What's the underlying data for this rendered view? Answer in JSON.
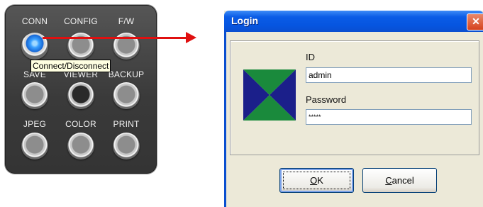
{
  "panel": {
    "buttons": [
      {
        "label": "CONN",
        "style": "blue"
      },
      {
        "label": "CONFIG",
        "style": "gray"
      },
      {
        "label": "F/W",
        "style": "gray"
      },
      {
        "label": "SAVE",
        "style": "gray"
      },
      {
        "label": "VIEWER",
        "style": "dark"
      },
      {
        "label": "BACKUP",
        "style": "gray"
      },
      {
        "label": "JPEG",
        "style": "gray"
      },
      {
        "label": "COLOR",
        "style": "gray"
      },
      {
        "label": "PRINT",
        "style": "gray"
      }
    ],
    "tooltip": "Connect/Disconnect"
  },
  "arrow_color": "#e01010",
  "login": {
    "title": "Login",
    "close_glyph": "✕",
    "id_label": "ID",
    "id_value": "admin",
    "password_label": "Password",
    "password_value": "*****",
    "ok_mnemonic": "O",
    "ok_rest": "K",
    "cancel_mnemonic": "C",
    "cancel_rest": "ancel",
    "logo_colors": {
      "side": "#1b1f8a",
      "top_bottom": "#1a8a3c"
    }
  }
}
